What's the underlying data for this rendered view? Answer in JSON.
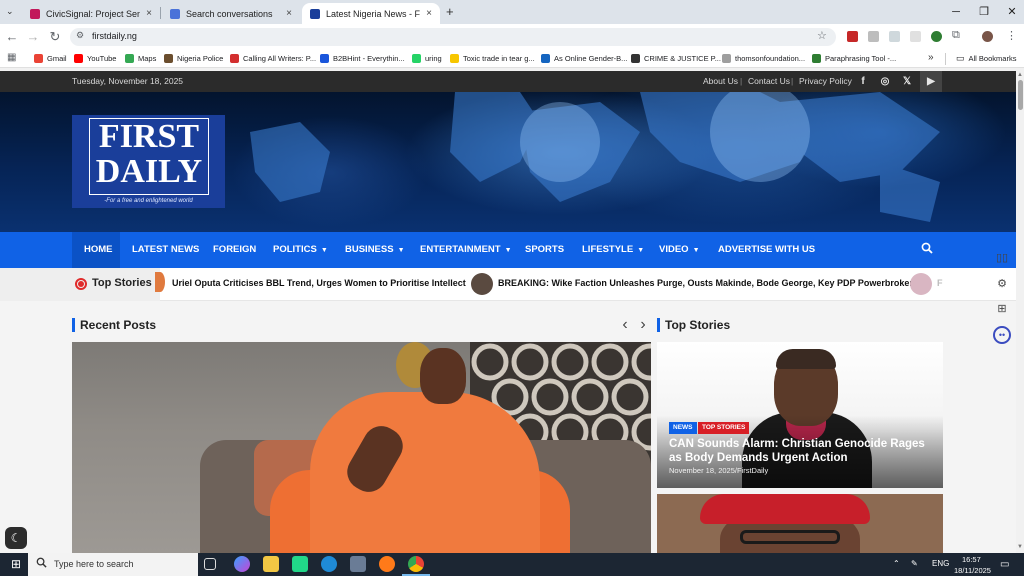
{
  "browser": {
    "tabs": [
      {
        "title": "CivicSignal: Project Sembra: Pro",
        "close": "×",
        "active": false,
        "favicon_color": "#c2185b"
      },
      {
        "title": "Search conversations",
        "close": "×",
        "active": false,
        "favicon_color": "#4a72d9"
      },
      {
        "title": "Latest Nigeria News - First Daily",
        "close": "×",
        "active": true,
        "favicon_color": "#1a3e9a"
      }
    ],
    "new_tab": "+",
    "window_controls": {
      "minimize": "─",
      "restore": "❐",
      "close": "✕"
    },
    "url": "firstdaily.ng",
    "bookmarks": [
      {
        "label": "Gmail",
        "color": "#ea4335"
      },
      {
        "label": "YouTube",
        "color": "#ff0000"
      },
      {
        "label": "Maps",
        "color": "#34a853"
      },
      {
        "label": "Nigeria Police",
        "color": "#6b4e2e"
      },
      {
        "label": "Calling All Writers: P...",
        "color": "#d32f2f"
      },
      {
        "label": "B2BHint - Everythin...",
        "color": "#1a56db"
      },
      {
        "label": "uring",
        "color": "#25d366"
      },
      {
        "label": "Toxic trade in tear g...",
        "color": "#f7c600"
      },
      {
        "label": "As Online Gender-B...",
        "color": "#1565c0"
      },
      {
        "label": "CRIME & JUSTICE P...",
        "color": "#333333"
      },
      {
        "label": "thomsonfoundation...",
        "color": "#9e9e9e"
      },
      {
        "label": "Paraphrasing Tool -...",
        "color": "#2e7d32"
      }
    ],
    "bookmarks_overflow": "»",
    "all_bookmarks": "All Bookmarks"
  },
  "site": {
    "date": "Tuesday, November 18, 2025",
    "top_links": [
      "About Us",
      "Contact Us",
      "Privacy Policy"
    ],
    "top_link_sep": "|",
    "social_icons": [
      "facebook-icon",
      "instagram-icon",
      "x-icon",
      "youtube-icon"
    ],
    "social_glyphs": [
      "f",
      "◎",
      "𝕏",
      "▶"
    ],
    "logo": {
      "line1": "FIRST",
      "line2": "DAILY",
      "tagline": "-For a free and enlightened world"
    },
    "nav": [
      {
        "label": "HOME",
        "dropdown": false
      },
      {
        "label": "LATEST NEWS",
        "dropdown": false
      },
      {
        "label": "FOREIGN",
        "dropdown": false
      },
      {
        "label": "POLITICS",
        "dropdown": true
      },
      {
        "label": "BUSINESS",
        "dropdown": true
      },
      {
        "label": "ENTERTAINMENT",
        "dropdown": true
      },
      {
        "label": "SPORTS",
        "dropdown": false
      },
      {
        "label": "LIFESTYLE",
        "dropdown": true
      },
      {
        "label": "VIDEO",
        "dropdown": true
      },
      {
        "label": "ADVERTISE WITH US",
        "dropdown": false
      }
    ],
    "ticker": {
      "label": "Top Stories",
      "items": [
        "Uriel Oputa Criticises BBL Trend, Urges Women to Prioritise Intellect",
        "BREAKING: Wike Faction Unleashes Purge, Ousts Makinde, Bode George, Key PDP Powerbrokers",
        "F"
      ]
    },
    "recent_posts_title": "Recent Posts",
    "top_stories_title": "Top Stories",
    "prev_arrow": "‹",
    "next_arrow": "›",
    "top_story_card": {
      "badges": [
        "NEWS",
        "TOP STORIES"
      ],
      "title": "CAN Sounds Alarm: Christian Genocide Rages as Body Demands Urgent Action",
      "meta": "November 18, 2025/FirstDaily"
    },
    "colors": {
      "nav_blue": "#1062e6",
      "badge_news": "#1062e6",
      "badge_top": "#d81f26",
      "ticker_red": "#e02b2b"
    }
  },
  "taskbar": {
    "search_placeholder": "Type here to search",
    "language": "ENG",
    "time": "16:57",
    "date": "18/11/2025"
  }
}
